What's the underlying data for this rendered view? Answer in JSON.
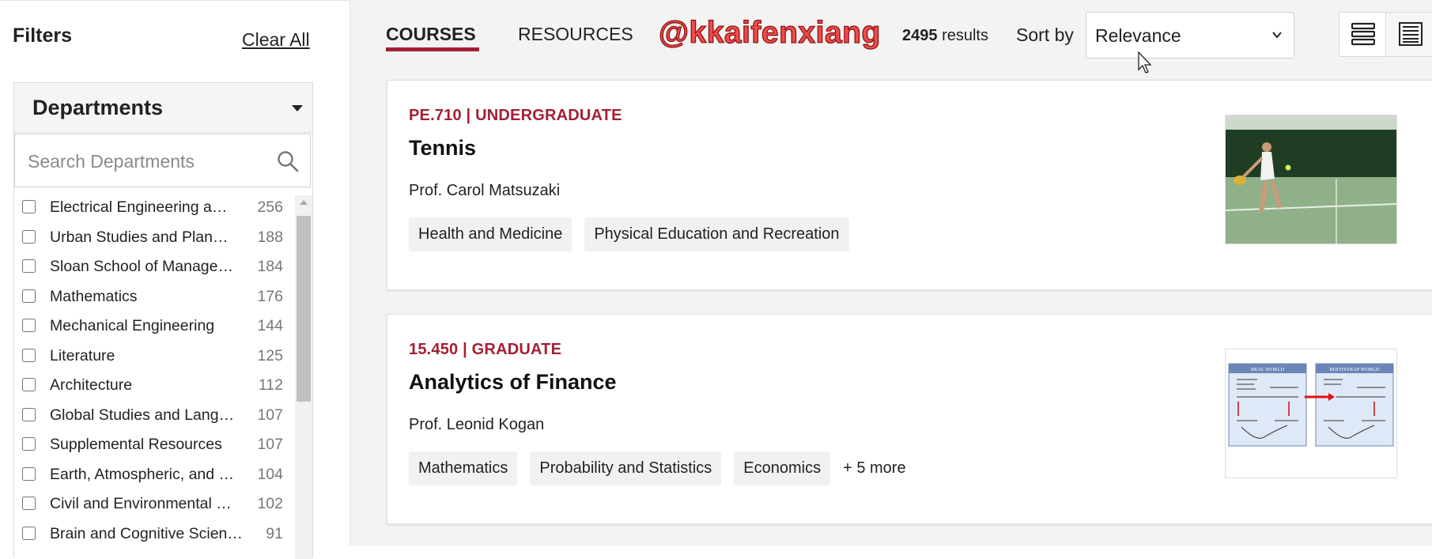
{
  "sidebar": {
    "title": "Filters",
    "clear_all": "Clear All",
    "departments": {
      "title": "Departments",
      "search_placeholder": "Search Departments",
      "items": [
        {
          "label": "Electrical Engineering a…",
          "count": "256"
        },
        {
          "label": "Urban Studies and Plan…",
          "count": "188"
        },
        {
          "label": "Sloan School of Manage…",
          "count": "184"
        },
        {
          "label": "Mathematics",
          "count": "176"
        },
        {
          "label": "Mechanical Engineering",
          "count": "144"
        },
        {
          "label": "Literature",
          "count": "125"
        },
        {
          "label": "Architecture",
          "count": "112"
        },
        {
          "label": "Global Studies and Lang…",
          "count": "107"
        },
        {
          "label": "Supplemental Resources",
          "count": "107"
        },
        {
          "label": "Earth, Atmospheric, and …",
          "count": "104"
        },
        {
          "label": "Civil and Environmental …",
          "count": "102"
        },
        {
          "label": "Brain and Cognitive Scien…",
          "count": "91"
        }
      ]
    }
  },
  "header": {
    "tabs": [
      {
        "label": "COURSES",
        "active": true
      },
      {
        "label": "RESOURCES",
        "active": false
      }
    ],
    "watermark": "@kkaifenxiang",
    "results_count": "2495",
    "results_label": "results",
    "sort_label": "Sort by",
    "sort_value": "Relevance"
  },
  "courses": [
    {
      "meta": "PE.710 | UNDERGRADUATE",
      "title": "Tennis",
      "instructor": "Prof. Carol Matsuzaki",
      "tags": [
        "Health and Medicine",
        "Physical Education and Recreation"
      ]
    },
    {
      "meta": "15.450 | GRADUATE",
      "title": "Analytics of Finance",
      "instructor": "Prof. Leonid Kogan",
      "tags": [
        "Mathematics",
        "Probability and Statistics",
        "Economics"
      ],
      "more": "+ 5 more"
    }
  ],
  "thumb_labels": {
    "real_world": "REAL WORLD",
    "bootstrap_world": "BOOTSTRAP WORLD"
  },
  "colors": {
    "accent": "#a31f34",
    "watermark": "#f04a4a"
  },
  "icons": [
    "search-icon",
    "caret-down-icon",
    "chevron-down-icon",
    "list-view-icon",
    "compact-view-icon",
    "cursor-icon"
  ]
}
